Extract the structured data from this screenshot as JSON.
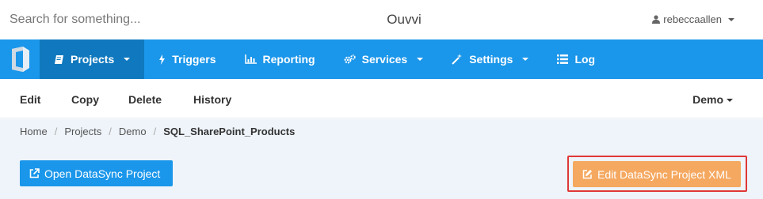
{
  "search": {
    "placeholder": "Search for something..."
  },
  "app": {
    "title": "Ouvvi"
  },
  "user": {
    "name": "rebeccaallen"
  },
  "nav": {
    "items": [
      {
        "label": "Projects",
        "icon": "book-icon",
        "active": true,
        "dropdown": true
      },
      {
        "label": "Triggers",
        "icon": "bolt-icon",
        "active": false,
        "dropdown": false
      },
      {
        "label": "Reporting",
        "icon": "bar-chart-icon",
        "active": false,
        "dropdown": false
      },
      {
        "label": "Services",
        "icon": "cogs-icon",
        "active": false,
        "dropdown": true
      },
      {
        "label": "Settings",
        "icon": "magic-wand-icon",
        "active": false,
        "dropdown": true
      },
      {
        "label": "Log",
        "icon": "list-icon",
        "active": false,
        "dropdown": false
      }
    ]
  },
  "subnav": {
    "items": [
      "Edit",
      "Copy",
      "Delete",
      "History"
    ],
    "environment": "Demo"
  },
  "breadcrumb": [
    "Home",
    "Projects",
    "Demo",
    "SQL_SharePoint_Products"
  ],
  "buttons": {
    "open": "Open DataSync Project",
    "edit": "Edit DataSync Project XML"
  },
  "colors": {
    "nav": "#1a96ea",
    "nav_active": "#0f78be",
    "primary": "#1a96ea",
    "warning": "#f5a860",
    "highlight": "#e03737",
    "content_bg": "#eef4fa"
  }
}
